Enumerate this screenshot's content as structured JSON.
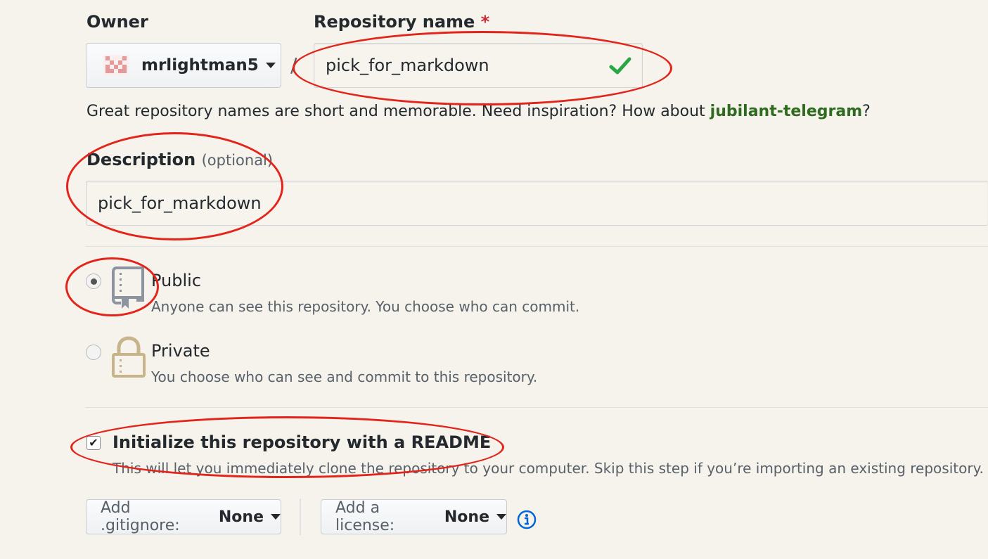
{
  "owner": {
    "label": "Owner",
    "username": "mrlightman5",
    "avatar_icon": "identicon-avatar"
  },
  "separator": "/",
  "repo_name": {
    "label": "Repository name",
    "required_mark": "*",
    "value": "pick_for_markdown",
    "valid_icon": "check-icon"
  },
  "suggestion": {
    "text_before": "Great repository names are short and memorable. Need inspiration? How about ",
    "suggested_name": "jubilant-telegram",
    "text_after": "?"
  },
  "description": {
    "label": "Description",
    "optional_label": "(optional)",
    "value": "pick_for_markdown"
  },
  "visibility": {
    "public": {
      "title": "Public",
      "subtitle": "Anyone can see this repository. You choose who can commit.",
      "selected": true,
      "icon": "repo-book-icon"
    },
    "private": {
      "title": "Private",
      "subtitle": "You choose who can see and commit to this repository.",
      "selected": false,
      "icon": "lock-icon"
    }
  },
  "readme": {
    "label": "Initialize this repository with a README",
    "help": "This will let you immediately clone the repository to your computer. Skip this step if you’re importing an existing repository.",
    "checked": true
  },
  "gitignore": {
    "prefix": "Add .gitignore:",
    "value": "None"
  },
  "license": {
    "prefix": "Add a license:",
    "value": "None"
  },
  "info_icon": "info-icon",
  "colors": {
    "background": "#f6f3ec",
    "link_green": "#2e6b1f",
    "annotation_red": "#e3241b",
    "required_red": "#cb2431",
    "check_green": "#28a745",
    "info_blue": "#0366d6"
  }
}
